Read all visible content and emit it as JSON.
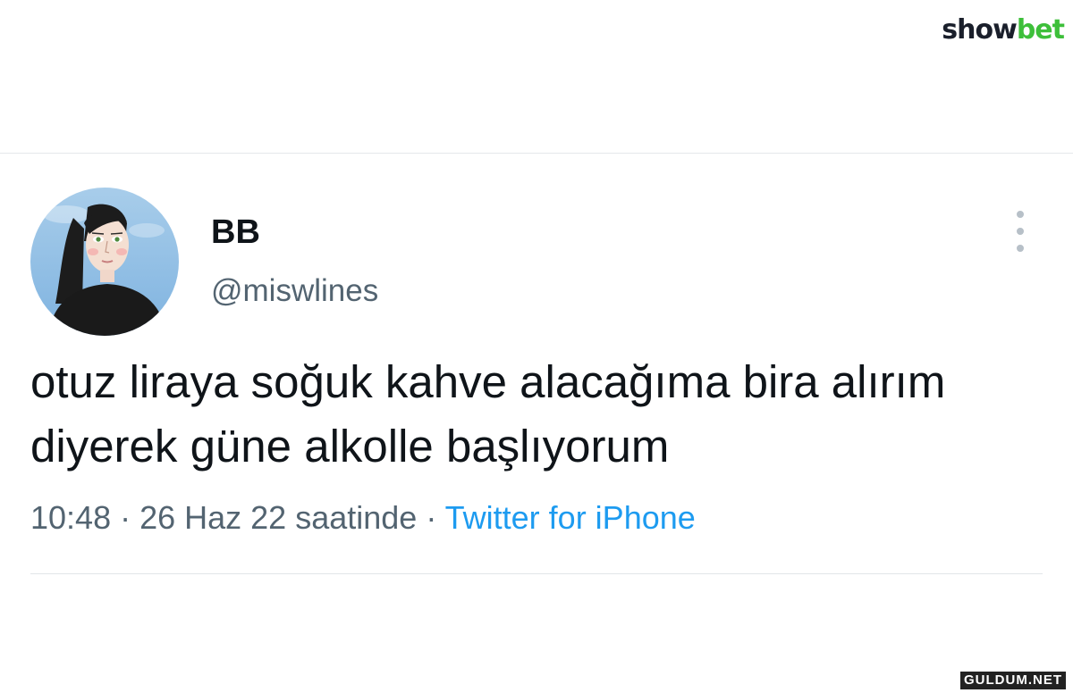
{
  "brand": {
    "part1": "show",
    "part2": "bet"
  },
  "tweet": {
    "display_name": "BB",
    "handle": "@miswlines",
    "text": "otuz liraya soğuk kahve alacağıma bira alırım diyerek güne alkolle başlıyorum",
    "time": "10:48",
    "separator1": " · ",
    "date": "26 Haz 22 saatinde",
    "separator2": " · ",
    "source": "Twitter for iPhone"
  },
  "watermark": "GULDUM.NET",
  "colors": {
    "accent": "#1d9bf0",
    "secondary_text": "#536471",
    "brand_green": "#3dbf3a"
  },
  "icons": {
    "more": "vertical-ellipsis-icon"
  }
}
